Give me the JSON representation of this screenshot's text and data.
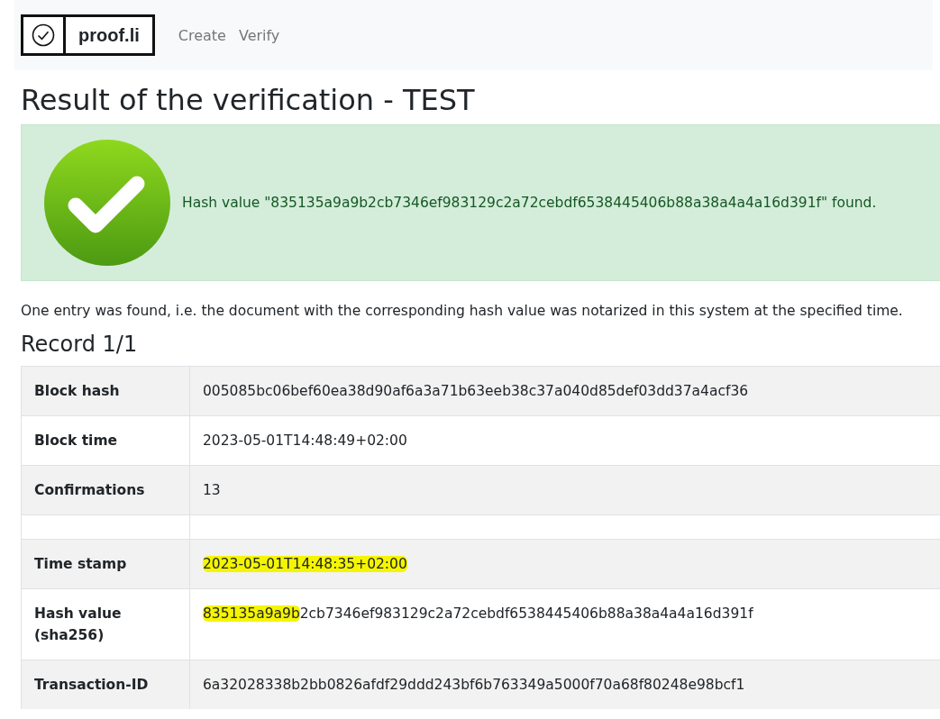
{
  "navbar": {
    "brand": "proof.li",
    "links": [
      {
        "label": "Create"
      },
      {
        "label": "Verify"
      }
    ]
  },
  "heading": "Result of the verification - TEST",
  "alert": {
    "kind": "success",
    "message": "Hash value \"835135a9a9b2cb7346ef983129c2a72cebdf6538445406b88a38a4a4a16d391f\" found."
  },
  "description": "One entry was found, i.e. the document with the corresponding hash value was notarized in this system at the specified time.",
  "record_title": "Record 1/1",
  "rows": [
    {
      "kind": "field",
      "label": "Block hash",
      "value_parts": [
        {
          "text": "005085bc06bef60ea38d90af6a3a71b63eeb38c37a040d85def03dd37a4acf36",
          "highlighted": false
        }
      ]
    },
    {
      "kind": "field",
      "label": "Block time",
      "value_parts": [
        {
          "text": "2023-05-01T14:48:49+02:00",
          "highlighted": false
        }
      ]
    },
    {
      "kind": "field",
      "label": "Confirmations",
      "value_parts": [
        {
          "text": "13",
          "highlighted": false
        }
      ]
    },
    {
      "kind": "blank"
    },
    {
      "kind": "field",
      "label": "Time stamp",
      "value_parts": [
        {
          "text": "2023-05-01T14:48:35+02:00",
          "highlighted": true
        }
      ]
    },
    {
      "kind": "field",
      "label": "Hash value (sha256)",
      "value_parts": [
        {
          "text": "835135a9a9b",
          "highlighted": true
        },
        {
          "text": "2cb7346ef983129c2a72cebdf6538445406b88a38a4a4a16d391f",
          "highlighted": false
        }
      ]
    },
    {
      "kind": "field",
      "label": "Transaction-ID",
      "value_parts": [
        {
          "text": "6a32028338b2bb0826afdf29ddd243bf6b763349a5000f70a68f80248e98bcf1",
          "highlighted": false
        }
      ]
    }
  ]
}
